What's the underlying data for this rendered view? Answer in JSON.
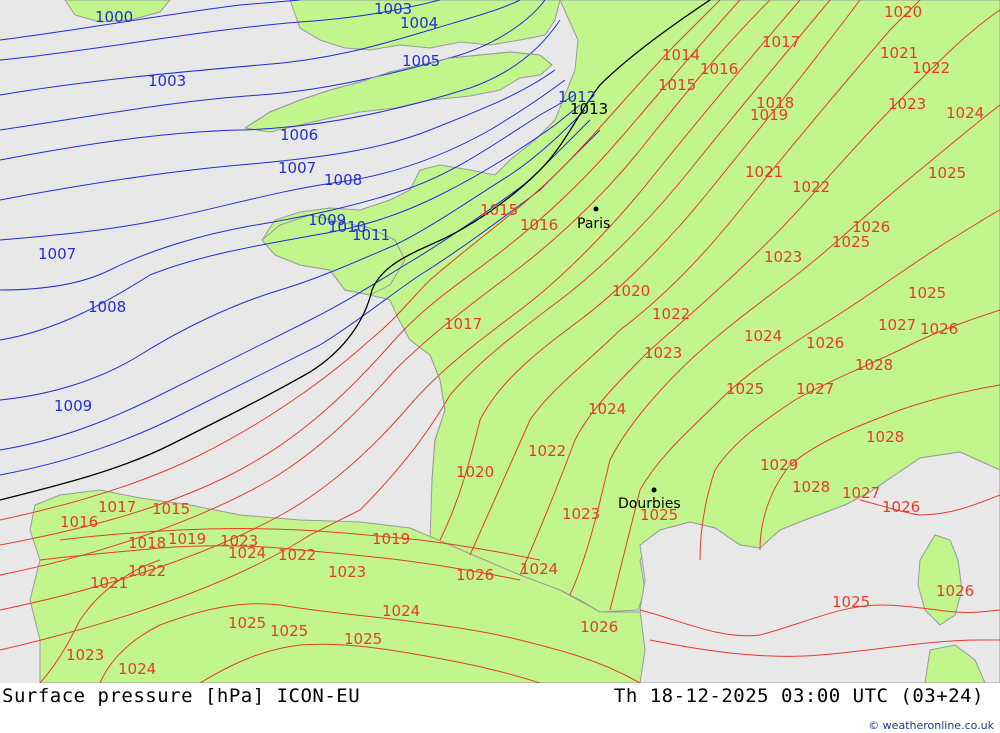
{
  "footer": {
    "product": "Surface pressure [hPa] ICON-EU",
    "valid_time": "Th 18-12-2025 03:00 UTC (03+24)",
    "credit": "© weatheronline.co.uk"
  },
  "colors": {
    "sea": "#e8e8e8",
    "land": "#c2f58c",
    "isobar_low": "#1f2fd6",
    "isobar_high": "#e43c2c",
    "isobar_1013": "#000000",
    "coast": "#9a9a9a"
  },
  "cities": [
    {
      "name": "Paris"
    },
    {
      "name": "Dourbies"
    }
  ],
  "isobar_labels": {
    "blue": [
      "1000",
      "1003",
      "1004",
      "1005",
      "1003",
      "1006",
      "1007",
      "1008",
      "1007",
      "1009",
      "1010",
      "1011",
      "1008",
      "1009",
      "1012"
    ],
    "black": [
      "1013"
    ],
    "red": [
      "1014",
      "1015",
      "1016",
      "1017",
      "1020",
      "1021",
      "1022",
      "1023",
      "1024",
      "1018",
      "1019",
      "1021",
      "1022",
      "1025",
      "1026",
      "1025",
      "1015",
      "1016",
      "1020",
      "1022",
      "1023",
      "1024",
      "1025",
      "1027",
      "1026",
      "1028",
      "1026",
      "1027",
      "1025",
      "1028",
      "1029",
      "1028",
      "1027",
      "1026",
      "1017",
      "1020",
      "1022",
      "1023",
      "1024",
      "1026",
      "1025",
      "1016",
      "1017",
      "1015",
      "1018",
      "1019",
      "1023",
      "1024",
      "1022",
      "1023",
      "1021",
      "1019",
      "1024",
      "1025",
      "1026",
      "1022",
      "1023",
      "1024",
      "1025",
      "1025",
      "1025",
      "1023",
      "1024",
      "1026"
    ]
  }
}
